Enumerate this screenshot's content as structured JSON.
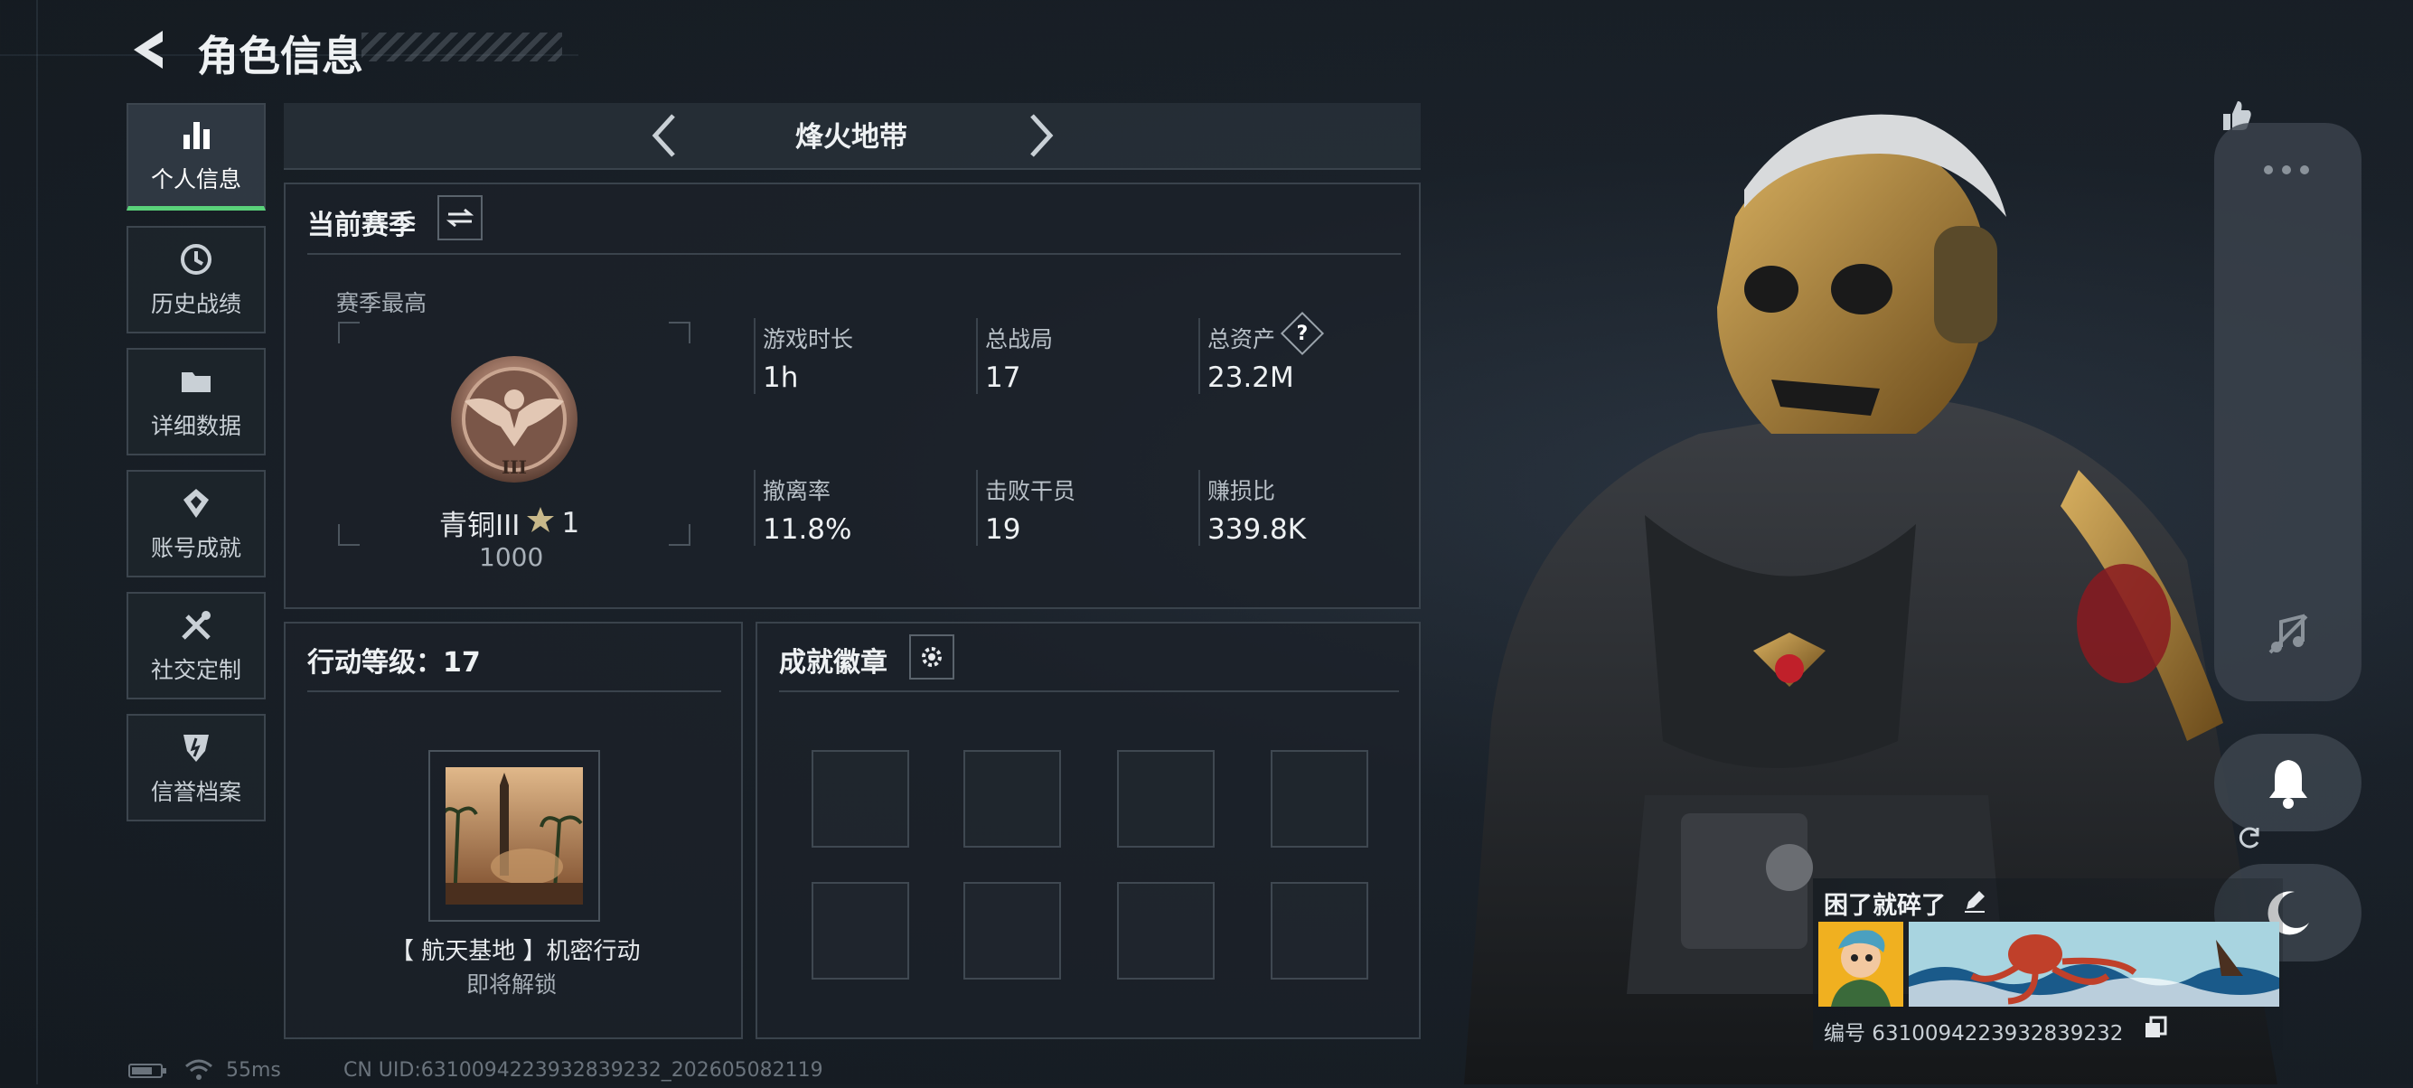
{
  "header": {
    "title": "角色信息"
  },
  "sidebar": {
    "items": [
      {
        "label": "个人信息",
        "icon": "bar-chart-icon",
        "active": true
      },
      {
        "label": "历史战绩",
        "icon": "history-icon"
      },
      {
        "label": "详细数据",
        "icon": "folder-icon"
      },
      {
        "label": "账号成就",
        "icon": "achievement-icon"
      },
      {
        "label": "社交定制",
        "icon": "tools-icon"
      },
      {
        "label": "信誉档案",
        "icon": "shield-icon"
      }
    ]
  },
  "mode_selector": {
    "label": "烽火地带"
  },
  "season": {
    "title": "当前赛季",
    "best_label": "赛季最高",
    "rank_name": "青铜III",
    "rank_stars": "1",
    "rank_score": "1000",
    "stats": [
      {
        "label": "游戏时长",
        "value": "1h"
      },
      {
        "label": "总战局",
        "value": "17"
      },
      {
        "label": "总资产",
        "value": "23.2M",
        "help": "?"
      },
      {
        "label": "撤离率",
        "value": "11.8%"
      },
      {
        "label": "击败干员",
        "value": "19"
      },
      {
        "label": "赚损比",
        "value": "339.8K"
      }
    ]
  },
  "action_level": {
    "title": "行动等级：17",
    "mission_name": "【 航天基地 】机密行动",
    "mission_status": "即将解锁"
  },
  "badges": {
    "title": "成就徽章",
    "slot_count": 8
  },
  "profile": {
    "nickname": "困了就碎了",
    "id_text": "编号 6310094223932839232"
  },
  "status_bar": {
    "ping": "55ms",
    "uid": "CN UID:6310094223932839232_202605082119"
  },
  "colors": {
    "accent_green": "#5ad27a",
    "panel_border": "#3a434c",
    "background": "#161c22"
  }
}
